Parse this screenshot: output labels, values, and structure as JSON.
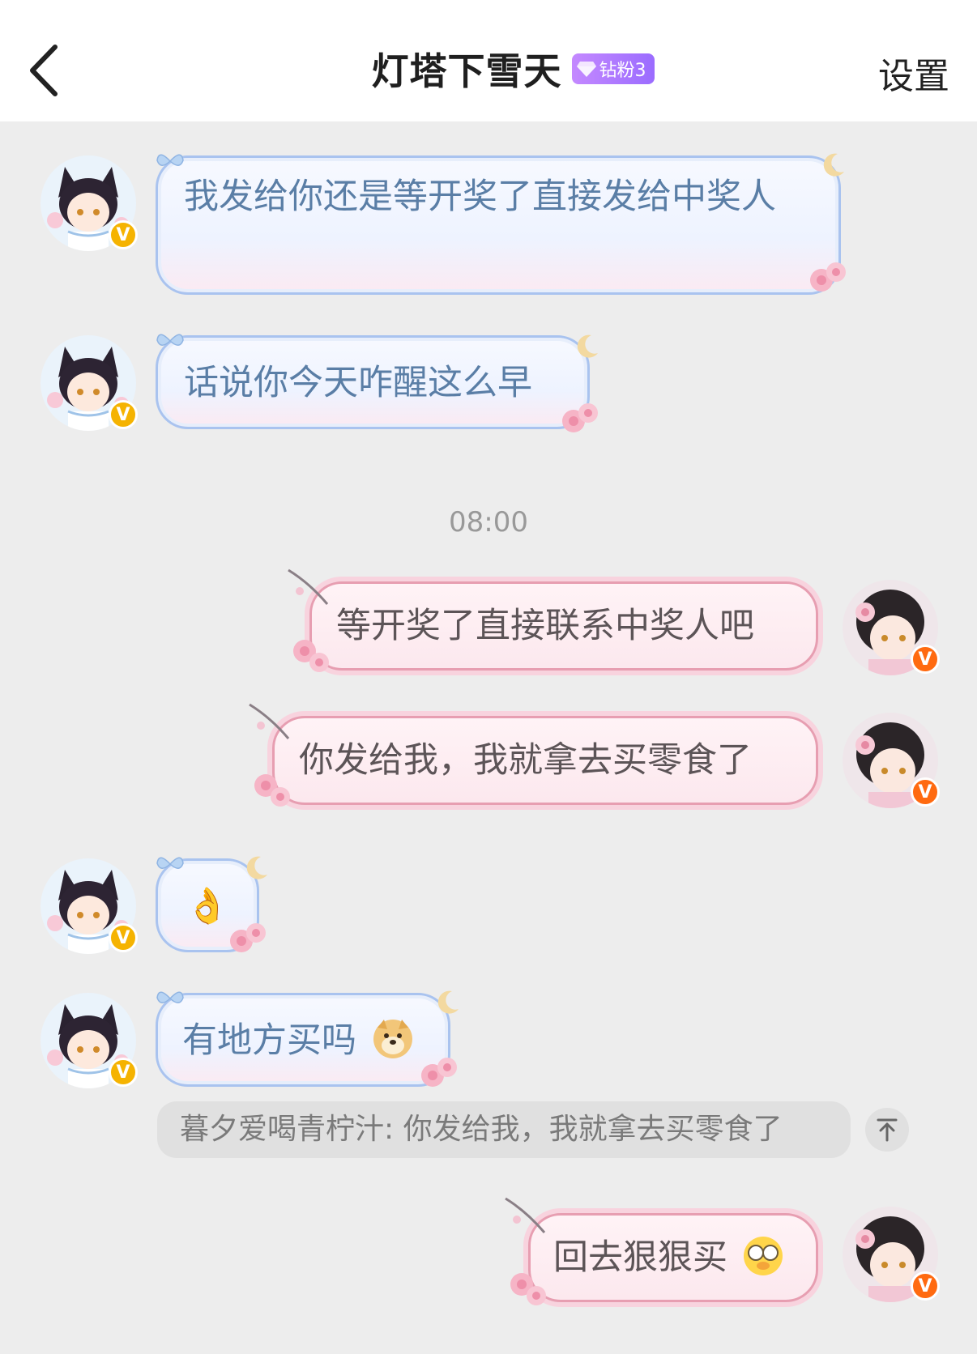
{
  "header": {
    "title": "灯塔下雪天",
    "fan_badge": "钻粉3",
    "settings_label": "设置"
  },
  "messages": {
    "m1": "我发给你还是等开奖了直接发给中奖人",
    "m2": "话说你今天咋醒这么早",
    "time": "08:00",
    "m3": "等开奖了直接联系中奖人吧",
    "m4": "你发给我，我就拿去买零食了",
    "m5_emoji": "👌",
    "m6": "有地方买吗",
    "quote": "暮夕爱喝青柠汁: 你发给我，我就拿去买零食了",
    "m7": "回去狠狠买"
  },
  "badges": {
    "verified": "V"
  },
  "colors": {
    "other_badge": "#f5b301",
    "self_badge": "#ff6a10",
    "fan_badge": "#b07cff"
  }
}
